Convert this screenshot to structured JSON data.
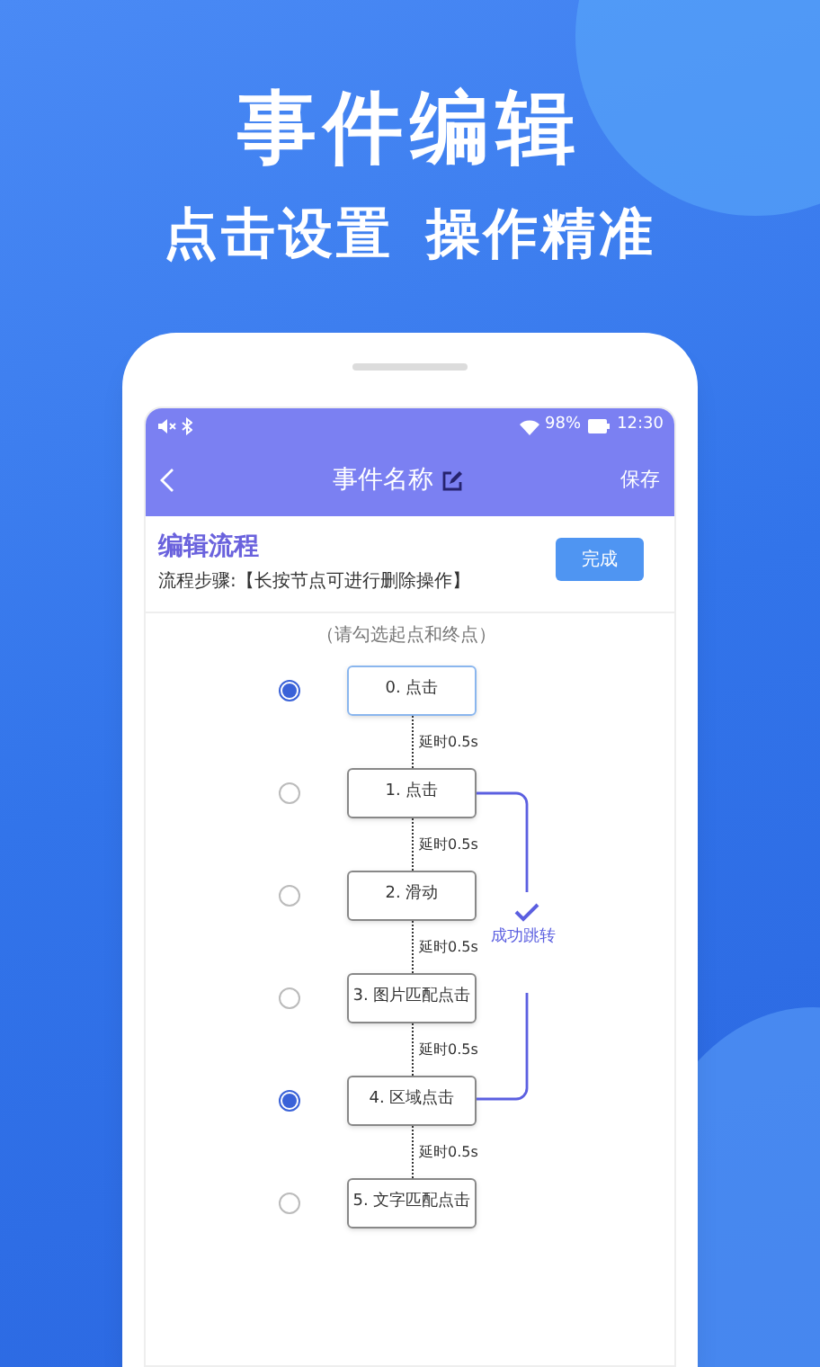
{
  "headline": "事件编辑",
  "subheadline": [
    "点击设置",
    "操作精准"
  ],
  "status_bar": {
    "battery": "98%",
    "time": "12:30"
  },
  "nav": {
    "title": "事件名称",
    "save": "保存"
  },
  "flow": {
    "title": "编辑流程",
    "instructions": "流程步骤:【长按节点可进行删除操作】",
    "done_button": "完成",
    "hint": "（请勾选起点和终点）",
    "steps": [
      {
        "label": "0. 点击",
        "selected": true,
        "highlighted": true,
        "delay": "延时0.5s"
      },
      {
        "label": "1. 点击",
        "selected": false,
        "highlighted": false,
        "delay": "延时0.5s"
      },
      {
        "label": "2. 滑动",
        "selected": false,
        "highlighted": false,
        "delay": "延时0.5s"
      },
      {
        "label": "3. 图片匹配点击",
        "selected": false,
        "highlighted": false,
        "delay": "延时0.5s"
      },
      {
        "label": "4. 区域点击",
        "selected": true,
        "highlighted": false,
        "delay": "延时0.5s"
      },
      {
        "label": "5. 文字匹配点击",
        "selected": false,
        "highlighted": false
      }
    ],
    "success_jump": {
      "label": "成功跳转"
    }
  }
}
